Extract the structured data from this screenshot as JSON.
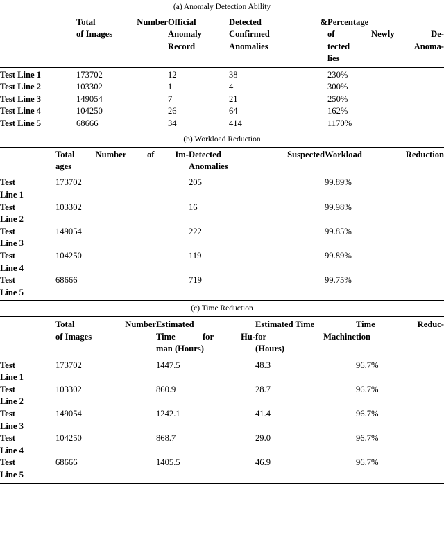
{
  "document": {
    "kind": "three-part-table-figure"
  },
  "table_a": {
    "caption": "(a) Anomaly Detection Ability",
    "headers": [
      "",
      "Total Number of Images",
      "Official Anomaly Record",
      "Detected & Confirmed Anomalies",
      "Percentage of Newly Detected Anomalies"
    ],
    "header_lines": [
      [
        ""
      ],
      [
        "Total Number",
        "of Images"
      ],
      [
        "Official",
        "Anomaly",
        "Record"
      ],
      [
        "Detected &",
        "Confirmed",
        "Anomalies"
      ],
      [
        "Percentage",
        "of Newly De-",
        "tected Anoma-",
        "lies"
      ]
    ],
    "rows": [
      {
        "label": "Test Line 1",
        "total_images": "173702",
        "official_anomaly_record": "12",
        "detected_confirmed_anomalies": "38",
        "percentage_newly_detected": "230%"
      },
      {
        "label": "Test Line 2",
        "total_images": "103302",
        "official_anomaly_record": "1",
        "detected_confirmed_anomalies": "4",
        "percentage_newly_detected": "300%"
      },
      {
        "label": "Test Line 3",
        "total_images": "149054",
        "official_anomaly_record": "7",
        "detected_confirmed_anomalies": "21",
        "percentage_newly_detected": "250%"
      },
      {
        "label": "Test Line 4",
        "total_images": "104250",
        "official_anomaly_record": "26",
        "detected_confirmed_anomalies": "64",
        "percentage_newly_detected": "162%"
      },
      {
        "label": "Test Line 5",
        "total_images": "68666",
        "official_anomaly_record": "34",
        "detected_confirmed_anomalies": "414",
        "percentage_newly_detected": "1170%"
      }
    ]
  },
  "table_b": {
    "caption": "(b) Workload Reduction",
    "headers": [
      "",
      "Total Number of Images",
      "Detected Suspected Anomalies",
      "Workload Reduction"
    ],
    "header_lines": [
      [
        ""
      ],
      [
        "Total Number of Im-",
        "ages"
      ],
      [
        "Detected Suspected",
        "Anomalies"
      ],
      [
        "Workload Reduction"
      ]
    ],
    "rows": [
      {
        "label": "Test Line 1",
        "label_lines": [
          "Test",
          "Line 1"
        ],
        "total_images": "173702",
        "detected_suspected_anomalies": "205",
        "workload_reduction": "99.89%"
      },
      {
        "label": "Test Line 2",
        "label_lines": [
          "Test",
          "Line 2"
        ],
        "total_images": "103302",
        "detected_suspected_anomalies": "16",
        "workload_reduction": "99.98%"
      },
      {
        "label": "Test Line 3",
        "label_lines": [
          "Test",
          "Line 3"
        ],
        "total_images": "149054",
        "detected_suspected_anomalies": "222",
        "workload_reduction": "99.85%"
      },
      {
        "label": "Test Line 4",
        "label_lines": [
          "Test",
          "Line 4"
        ],
        "total_images": "104250",
        "detected_suspected_anomalies": "119",
        "workload_reduction": "99.89%"
      },
      {
        "label": "Test Line 5",
        "label_lines": [
          "Test",
          "Line 5"
        ],
        "total_images": "68666",
        "detected_suspected_anomalies": "719",
        "workload_reduction": "99.75%"
      }
    ]
  },
  "table_c": {
    "caption": "(c) Time Reduction",
    "headers": [
      "",
      "Total Number of Images",
      "Estimated Time for Human (Hours)",
      "Estimated Time for Machine (Hours)",
      "Time Reduction"
    ],
    "header_lines": [
      [
        ""
      ],
      [
        "Total Number",
        "of Images"
      ],
      [
        "Estimated",
        "Time for Hu-",
        "man (Hours)"
      ],
      [
        "Estimated Time",
        "for Machine",
        "(Hours)"
      ],
      [
        "Time",
        "tion"
      ]
    ],
    "header_c4_overflow": "Reduc-",
    "rows": [
      {
        "label": "Test Line 1",
        "label_lines": [
          "Test",
          "Line 1"
        ],
        "total_images": "173702",
        "estimated_time_human": "1447.5",
        "estimated_time_machine": "48.3",
        "time_reduction": "96.7%"
      },
      {
        "label": "Test Line 2",
        "label_lines": [
          "Test",
          "Line 2"
        ],
        "total_images": "103302",
        "estimated_time_human": "860.9",
        "estimated_time_machine": "28.7",
        "time_reduction": "96.7%"
      },
      {
        "label": "Test Line 3",
        "label_lines": [
          "Test",
          "Line 3"
        ],
        "total_images": "149054",
        "estimated_time_human": "1242.1",
        "estimated_time_machine": "41.4",
        "time_reduction": "96.7%"
      },
      {
        "label": "Test Line 4",
        "label_lines": [
          "Test",
          "Line 4"
        ],
        "total_images": "104250",
        "estimated_time_human": "868.7",
        "estimated_time_machine": "29.0",
        "time_reduction": "96.7%"
      },
      {
        "label": "Test Line 5",
        "label_lines": [
          "Test",
          "Line 5"
        ],
        "total_images": "68666",
        "estimated_time_human": "1405.5",
        "estimated_time_machine": "46.9",
        "time_reduction": "96.7%"
      }
    ]
  }
}
